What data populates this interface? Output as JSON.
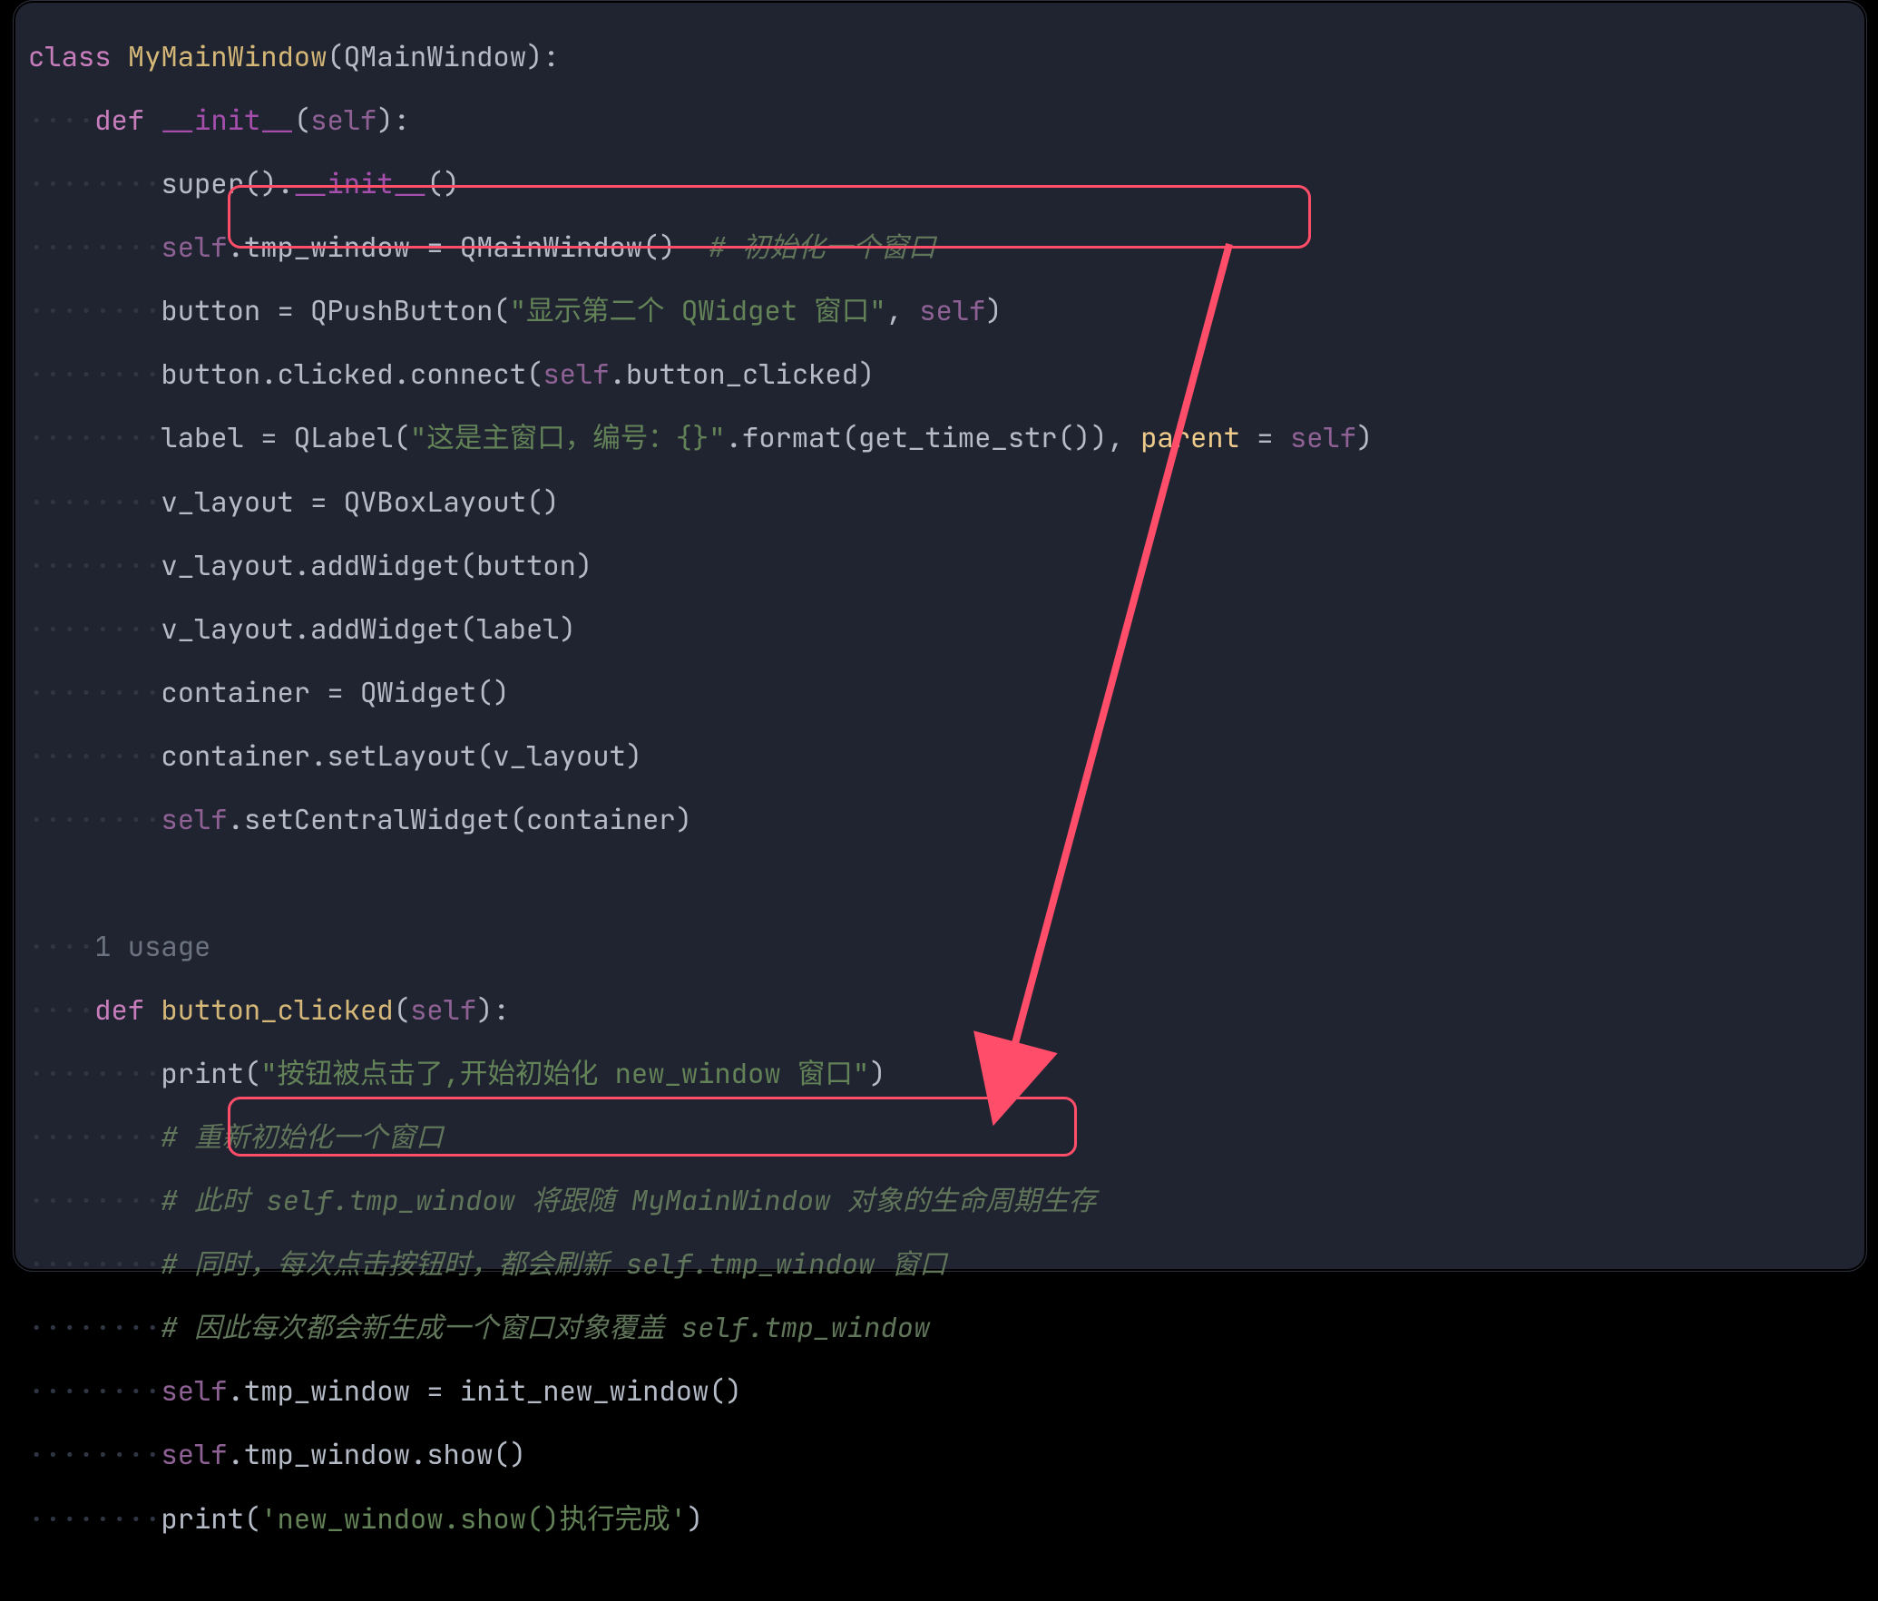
{
  "code": {
    "class_kw": "class",
    "class_name": "MyMainWindow",
    "class_base": "QMainWindow",
    "def_kw": "def",
    "init_name": "__init__",
    "self": "self",
    "super_call": "super().",
    "tmp_assign_lhs": ".tmp_window = ",
    "qmain_call": "QMainWindow()",
    "cmt_init": "# 初始化一个窗口",
    "button_assign": "button = QPushButton(",
    "button_str": "\"显示第二个 QWidget 窗口\"",
    "button_tail": ", ",
    "button_close": ")",
    "clicked_line": "button.clicked.connect(",
    "clicked_attr": ".button_clicked)",
    "label_assign": "label = QLabel(",
    "label_str": "\"这是主窗口，编号：{}\"",
    "format_call": ".format(get_time_str()), ",
    "parent_kw": "parent",
    "parent_eq": " = ",
    "self_close": ")",
    "vlayout_line": "v_layout = QVBoxLayout()",
    "add_button": "v_layout.addWidget(button)",
    "add_label": "v_layout.addWidget(label)",
    "container_line": "container = QWidget()",
    "setlayout_line": "container.setLayout(v_layout)",
    "setcentral_pre": ".setCentralWidget(container)",
    "usage_label": "1 usage",
    "bc_name": "button_clicked",
    "print1_pre": "print(",
    "print1_str": "\"按钮被点击了,开始初始化 new_window 窗口\"",
    "print1_close": ")",
    "cmt_reinit": "# 重新初始化一个窗口",
    "cmt_life": "# 此时 self.tmp_window 将跟随 MyMainWindow 对象的生命周期生存",
    "cmt_refresh": "# 同时，每次点击按钮时，都会刷新 self.tmp_window 窗口",
    "cmt_cover": "# 因此每次都会新生成一个窗口对象覆盖 self.tmp_window",
    "tmp_assign2_rhs": ".tmp_window = init_new_window()",
    "show_line": ".tmp_window.show()",
    "print2_pre": "print(",
    "print2_str": "'new_window.show()执行完成'",
    "print2_close": ")"
  },
  "annotations": {
    "box1": "highlight-box-init-tmp-window",
    "box2": "highlight-box-reassign-tmp-window",
    "arrow": "arrow-init-to-reassign"
  },
  "colors": {
    "highlight": "#ff4d6a",
    "bg": "#1f2430"
  }
}
